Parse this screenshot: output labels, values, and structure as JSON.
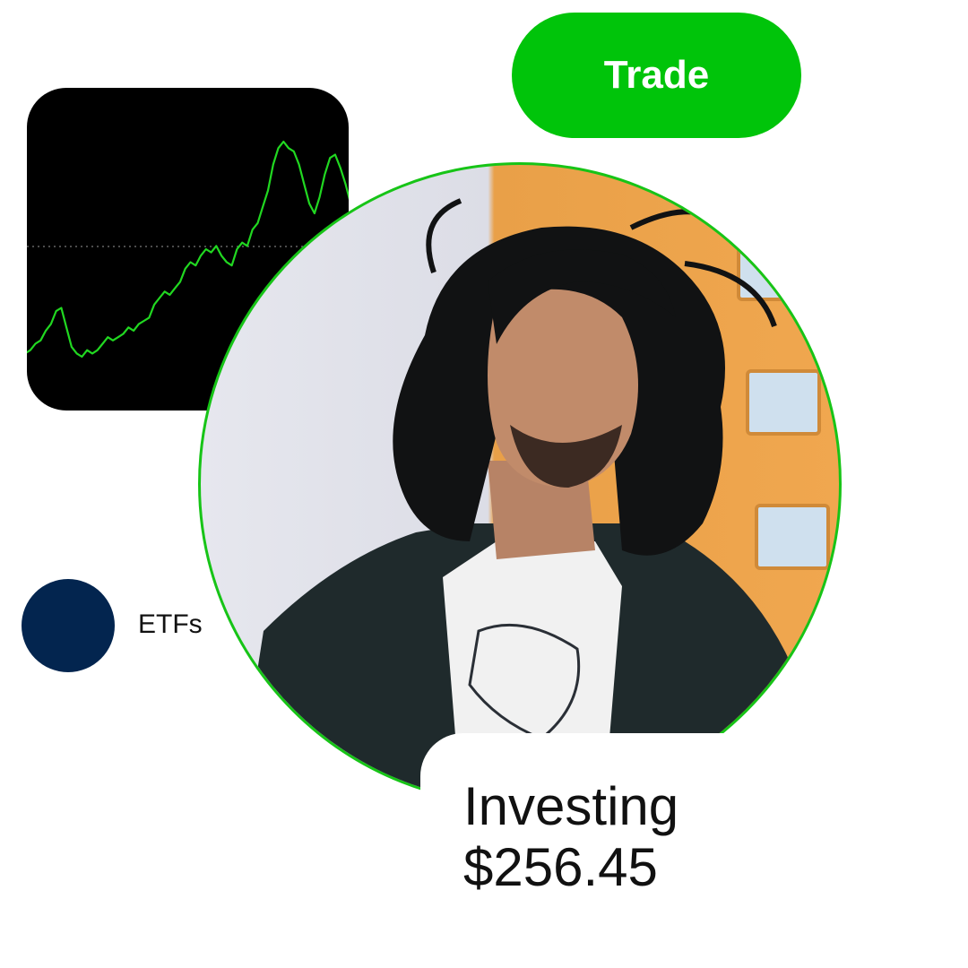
{
  "colors": {
    "accent_green": "#00c40a",
    "chart_line": "#21d821",
    "chart_background": "#000000",
    "photo_ring": "#17c417",
    "etf_dot": "#03254f"
  },
  "trade_button": {
    "label": "Trade"
  },
  "stock_chart": {
    "chart_data": {
      "type": "line",
      "title": "",
      "xlabel": "",
      "ylabel": "",
      "grid": false,
      "reference_line": "dotted-horizontal",
      "series": [
        {
          "values": [
            30,
            31,
            33,
            34,
            37,
            39,
            43,
            44,
            38,
            32,
            30,
            29,
            31,
            30,
            31,
            33,
            35,
            34,
            35,
            36,
            38,
            37,
            39,
            40,
            41,
            45,
            47,
            49,
            48,
            50,
            52,
            56,
            58,
            57,
            60,
            62,
            61,
            63,
            60,
            58,
            57,
            62,
            64,
            63,
            68,
            70,
            75,
            80,
            88,
            93,
            95,
            93,
            92,
            88,
            82,
            76,
            73,
            78,
            85,
            90,
            91,
            87,
            82,
            76,
            74
          ]
        }
      ]
    }
  },
  "etf": {
    "label": "ETFs",
    "icon": "circle-icon"
  },
  "investing": {
    "title": "Investing",
    "amount": "$256.45"
  }
}
